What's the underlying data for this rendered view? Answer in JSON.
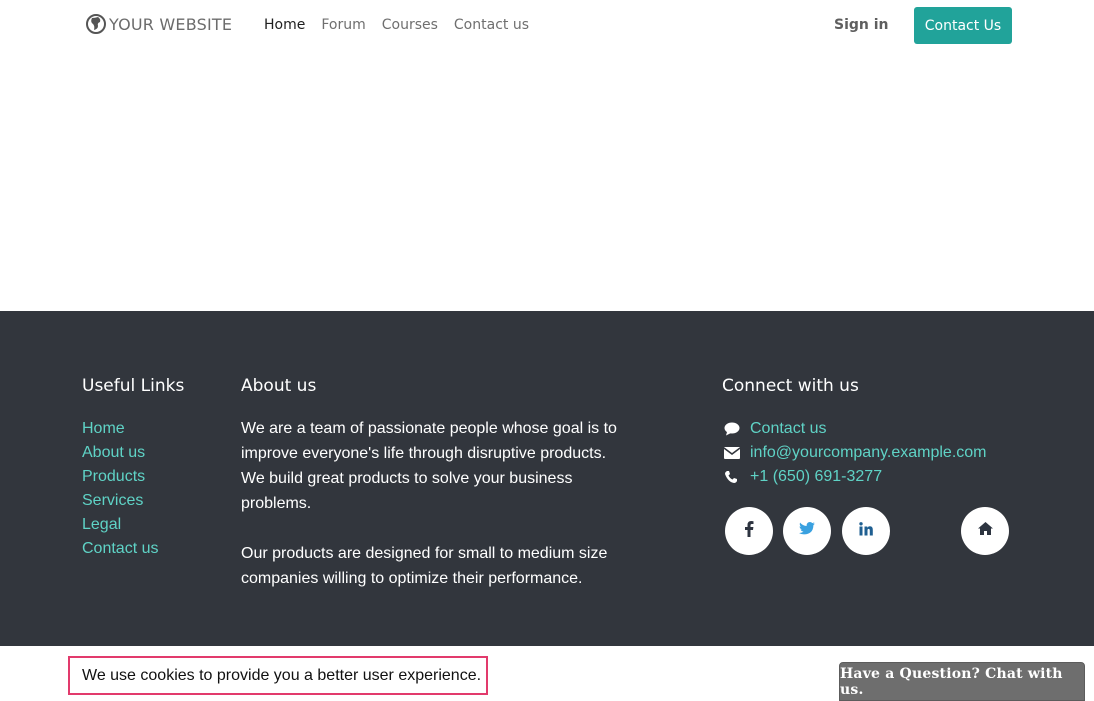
{
  "header": {
    "logo_text": "YOUR WEBSITE",
    "nav": [
      "Home",
      "Forum",
      "Courses",
      "Contact us"
    ],
    "active_nav": "Home",
    "signin_label": "Sign in",
    "cta_label": "Contact Us"
  },
  "footer": {
    "useful_links": {
      "title": "Useful Links",
      "items": [
        "Home",
        "About us",
        "Products",
        "Services",
        "Legal",
        "Contact us"
      ]
    },
    "about": {
      "title": "About us",
      "para1": "We are a team of passionate people whose goal is to improve everyone's life through disruptive products. We build great products to solve your business problems.",
      "para2": "Our products are designed for small to medium size companies willing to optimize their performance."
    },
    "connect": {
      "title": "Connect with us",
      "contact_label": "Contact us",
      "email": "info@yourcompany.example.com",
      "phone": "+1 (650) 691-3277",
      "social_icons": [
        "facebook-icon",
        "twitter-icon",
        "linkedin-icon",
        "home-icon"
      ]
    }
  },
  "cookie": {
    "message": "We use cookies to provide you a better user experience."
  },
  "chat": {
    "label": "Have a Question? Chat with us."
  },
  "colors": {
    "accent": "#21a39a",
    "link": "#5fd3c6",
    "footer_bg": "#32363d",
    "highlight_border": "#e23a6c",
    "chat_bg": "#6e6e6e"
  }
}
